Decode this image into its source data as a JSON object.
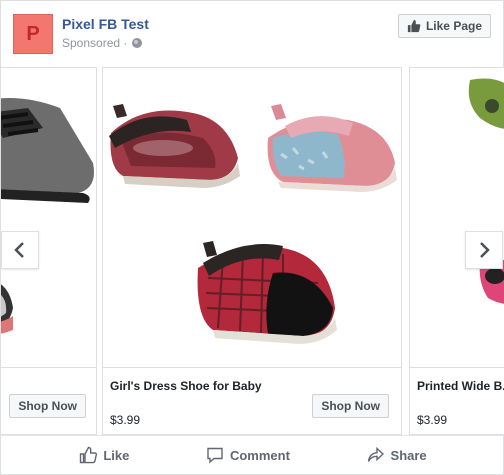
{
  "header": {
    "avatar_letter": "P",
    "page_name": "Pixel FB Test",
    "sponsored": "Sponsored ·",
    "like_page_label": "Like Page"
  },
  "carousel": {
    "cards": [
      {
        "title": "",
        "price": "",
        "button": "Shop Now"
      },
      {
        "title": "Girl's Dress Shoe for Baby",
        "price": "$3.99",
        "button": "Shop Now"
      },
      {
        "title": "Printed Wide B... Clog",
        "price": "$3.99",
        "button": ""
      }
    ]
  },
  "actions": {
    "like": "Like",
    "comment": "Comment",
    "share": "Share"
  },
  "colors": {
    "link_blue": "#365899",
    "avatar_bg": "#f4776f",
    "avatar_letter": "#c0282a",
    "action_gray": "#606770"
  }
}
